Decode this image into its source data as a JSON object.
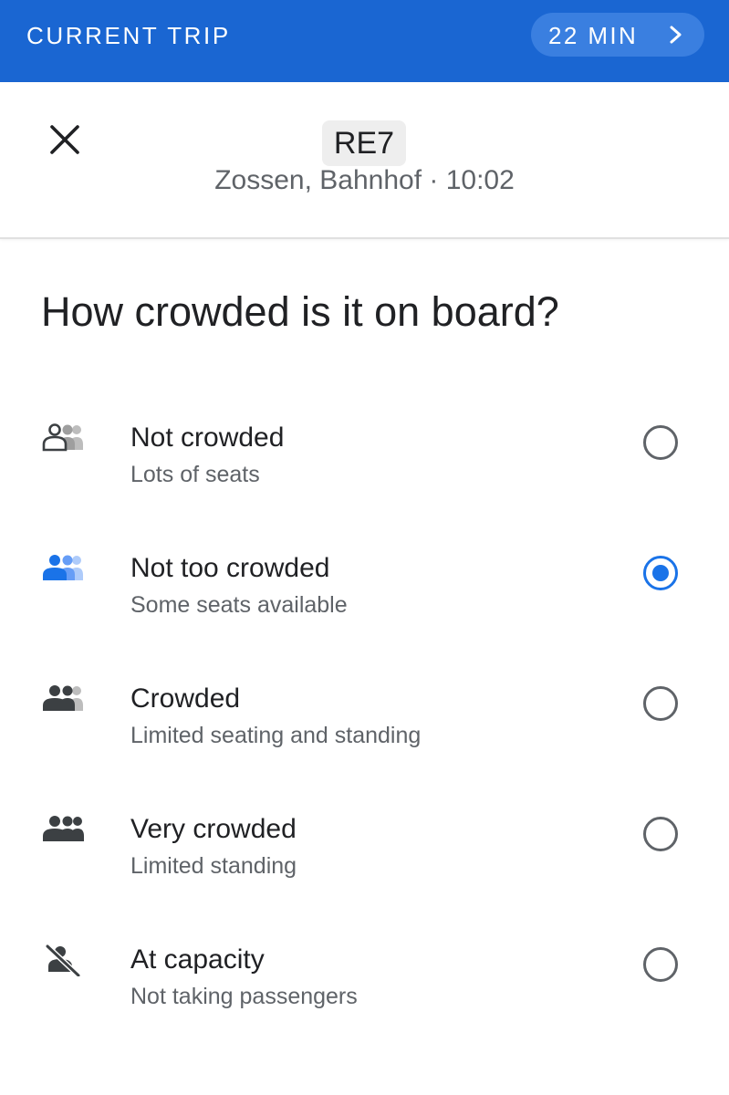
{
  "trip_bar": {
    "label": "CURRENT TRIP",
    "eta": "22 MIN",
    "eta_icon": "chevron-right-icon",
    "background_color": "#1a66d2"
  },
  "header": {
    "close_icon": "close-icon",
    "route": "RE7",
    "subtitle": "Zossen, Bahnhof · 10:02"
  },
  "question": "How crowded is it on board?",
  "options": [
    {
      "title": "Not crowded",
      "subtitle": "Lots of seats",
      "icon": "people-one-icon",
      "selected": false
    },
    {
      "title": "Not too crowded",
      "subtitle": "Some seats available",
      "icon": "people-two-icon",
      "selected": true
    },
    {
      "title": "Crowded",
      "subtitle": "Limited seating and standing",
      "icon": "people-three-icon",
      "selected": false
    },
    {
      "title": "Very crowded",
      "subtitle": "Limited standing",
      "icon": "people-full-icon",
      "selected": false
    },
    {
      "title": "At capacity",
      "subtitle": "Not taking passengers",
      "icon": "no-passengers-icon",
      "selected": false
    }
  ],
  "colors": {
    "accent": "#1a73e8",
    "text_primary": "#202124",
    "text_secondary": "#5f6368"
  }
}
